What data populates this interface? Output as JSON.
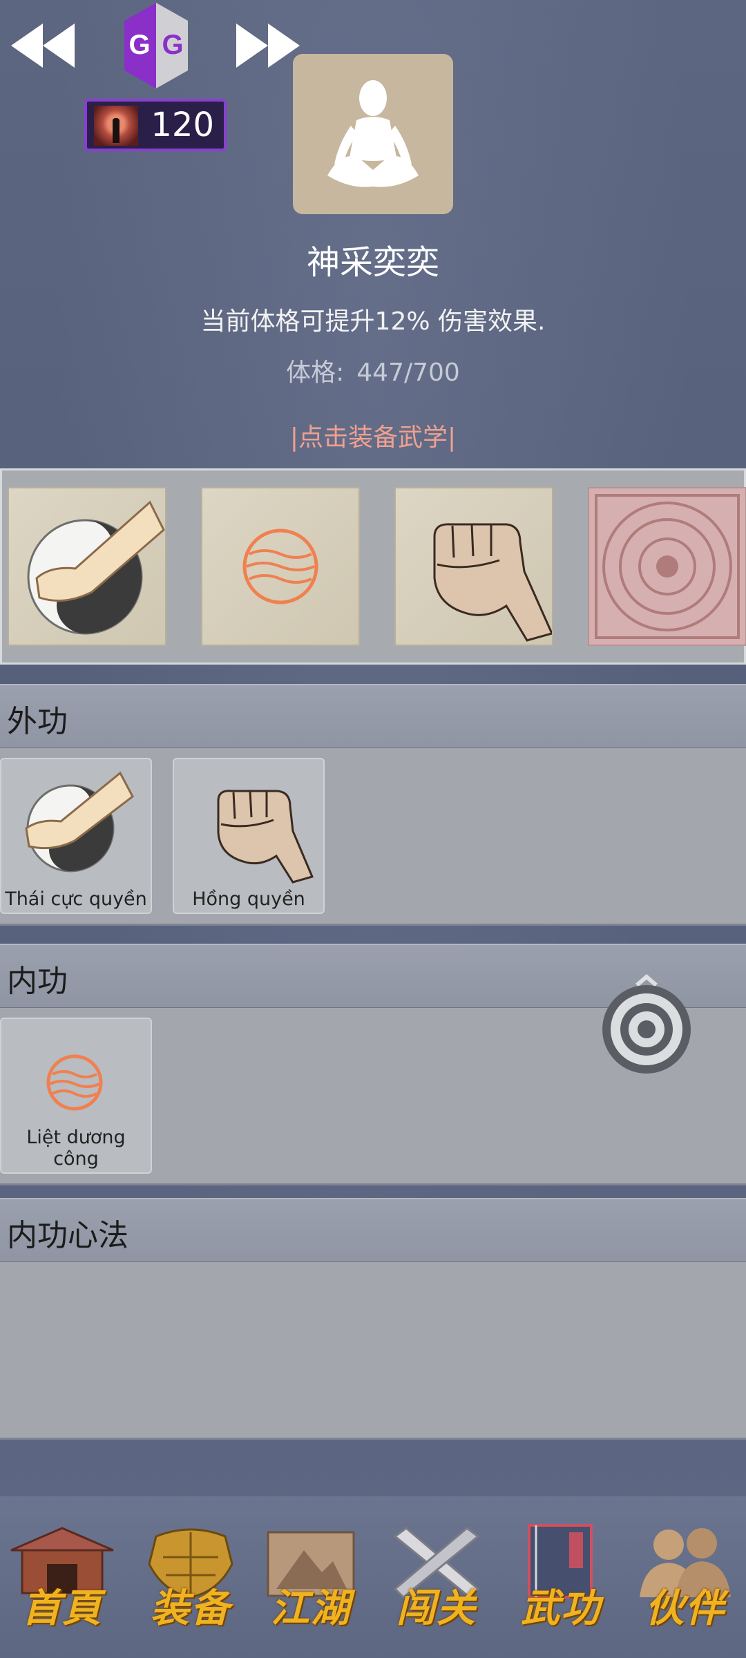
{
  "top": {
    "currency_amount": "120"
  },
  "profile": {
    "title": "神采奕奕",
    "description": "当前体格可提升12% 伤害效果.",
    "stat_label": "体格:",
    "stat_value": "447/700",
    "equip_link": "|点击装备武学|"
  },
  "equipped": {
    "slots": [
      "tai-chi-fist",
      "fire-orb",
      "fist",
      "aztec-seal"
    ]
  },
  "sections": [
    {
      "title": "外功",
      "skills": [
        {
          "label": "Thái cực quyền",
          "icon": "tai-chi-fist"
        },
        {
          "label": "Hồng quyền",
          "icon": "fist"
        }
      ]
    },
    {
      "title": "内功",
      "skills": [
        {
          "label": "Liệt dương công",
          "icon": "fire-orb"
        }
      ]
    },
    {
      "title": "内功心法",
      "skills": []
    }
  ],
  "bottom_nav": [
    {
      "label": "首頁",
      "icon": "temple-icon"
    },
    {
      "label": "装备",
      "icon": "armor-icon"
    },
    {
      "label": "江湖",
      "icon": "scroll-icon"
    },
    {
      "label": "闯关",
      "icon": "crossed-swords-icon"
    },
    {
      "label": "武功",
      "icon": "book-icon",
      "active": true
    },
    {
      "label": "伙伴",
      "icon": "partners-icon"
    }
  ],
  "colors": {
    "background": "#5d6882",
    "accent_link": "#f0a090",
    "nav_label": "#f0b320",
    "currency_border": "#8a3fd0"
  }
}
